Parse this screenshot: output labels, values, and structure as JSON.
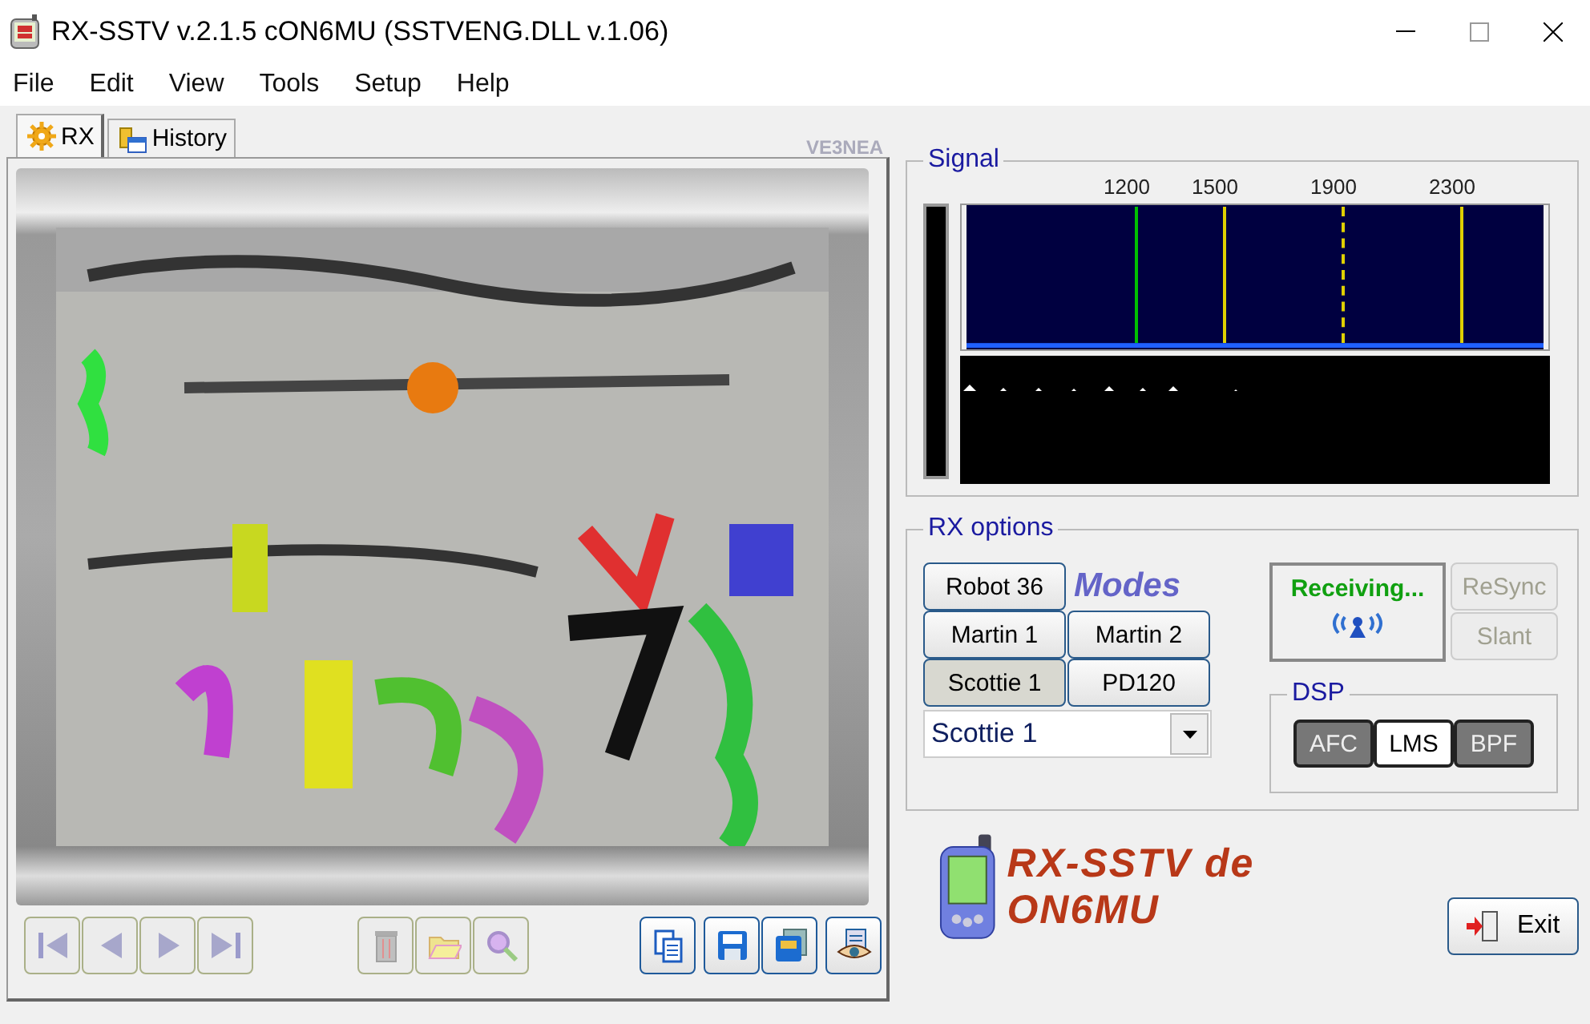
{
  "window": {
    "title": "RX-SSTV v.2.1.5 cON6MU (SSTVENG.DLL v.1.06)"
  },
  "menu": [
    "File",
    "Edit",
    "View",
    "Tools",
    "Setup",
    "Help"
  ],
  "tabs": [
    {
      "label": "RX",
      "selected": true,
      "kind": "gear"
    },
    {
      "label": "History",
      "selected": false,
      "kind": "history"
    }
  ],
  "credit": "VE3NEA",
  "nav_buttons": [
    {
      "kind": "first",
      "disabled": true
    },
    {
      "kind": "prev",
      "disabled": true
    },
    {
      "kind": "next",
      "disabled": true
    },
    {
      "kind": "last",
      "disabled": true
    }
  ],
  "file_buttons": [
    {
      "kind": "trash",
      "disabled": true
    },
    {
      "kind": "folder",
      "disabled": true
    },
    {
      "kind": "zoom",
      "disabled": true
    }
  ],
  "save_buttons": [
    {
      "kind": "copy",
      "disabled": false
    },
    {
      "kind": "save",
      "disabled": false
    },
    {
      "kind": "saveas",
      "disabled": false
    },
    {
      "kind": "view",
      "disabled": false
    }
  ],
  "signal": {
    "title": "Signal",
    "markers": [
      {
        "label": "1200",
        "color": "#00c000",
        "dashed": false
      },
      {
        "label": "1500",
        "color": "#e0d000",
        "dashed": false
      },
      {
        "label": "1900",
        "color": "#e0d000",
        "dashed": true
      },
      {
        "label": "2300",
        "color": "#e0d000",
        "dashed": false
      }
    ]
  },
  "rx_options": {
    "title": "RX options",
    "modes_logo": "Modes",
    "modes": [
      {
        "label": "Robot 36",
        "selected": false
      },
      {
        "label": "Martin 1",
        "selected": false
      },
      {
        "label": "Martin 2",
        "selected": false
      },
      {
        "label": "Scottie 1",
        "selected": true
      },
      {
        "label": "PD120",
        "selected": false
      }
    ],
    "mode_select": {
      "value": "Scottie 1"
    },
    "status": "Receiving...",
    "sync_buttons": [
      {
        "label": "ReSync",
        "disabled": true
      },
      {
        "label": "Slant",
        "disabled": true
      }
    ],
    "dsp": {
      "title": "DSP",
      "filters": [
        {
          "label": "AFC",
          "on": true
        },
        {
          "label": "LMS",
          "on": false
        },
        {
          "label": "BPF",
          "on": true
        }
      ]
    }
  },
  "logo": "RX-SSTV de ON6MU",
  "exit": "Exit"
}
